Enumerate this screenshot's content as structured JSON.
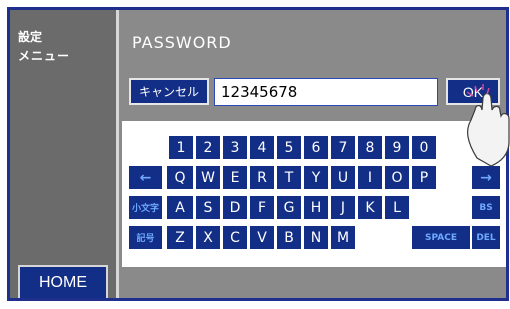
{
  "sidebar": {
    "title": "設定",
    "subtitle": "メニュー",
    "home_label": "HOME"
  },
  "screen": {
    "title": "PASSWORD"
  },
  "password": {
    "value": "12345678",
    "cancel_label": "キャンセル",
    "ok_label": "OK"
  },
  "keyboard": {
    "row1": [
      "1",
      "2",
      "3",
      "4",
      "5",
      "6",
      "7",
      "8",
      "9",
      "0"
    ],
    "row2": [
      "←",
      "Q",
      "W",
      "E",
      "R",
      "T",
      "Y",
      "U",
      "I",
      "O",
      "P",
      "→"
    ],
    "row3": [
      "小文字",
      "A",
      "S",
      "D",
      "F",
      "G",
      "H",
      "J",
      "K",
      "L",
      "BS"
    ],
    "row4": [
      "記号",
      "Z",
      "X",
      "C",
      "V",
      "B",
      "N",
      "M",
      "SPACE",
      "DEL"
    ]
  },
  "colors": {
    "primary": "#132e86",
    "panel": "#8a8a8a",
    "sidebar": "#6b6b6b",
    "accent": "#6ea8ff"
  }
}
